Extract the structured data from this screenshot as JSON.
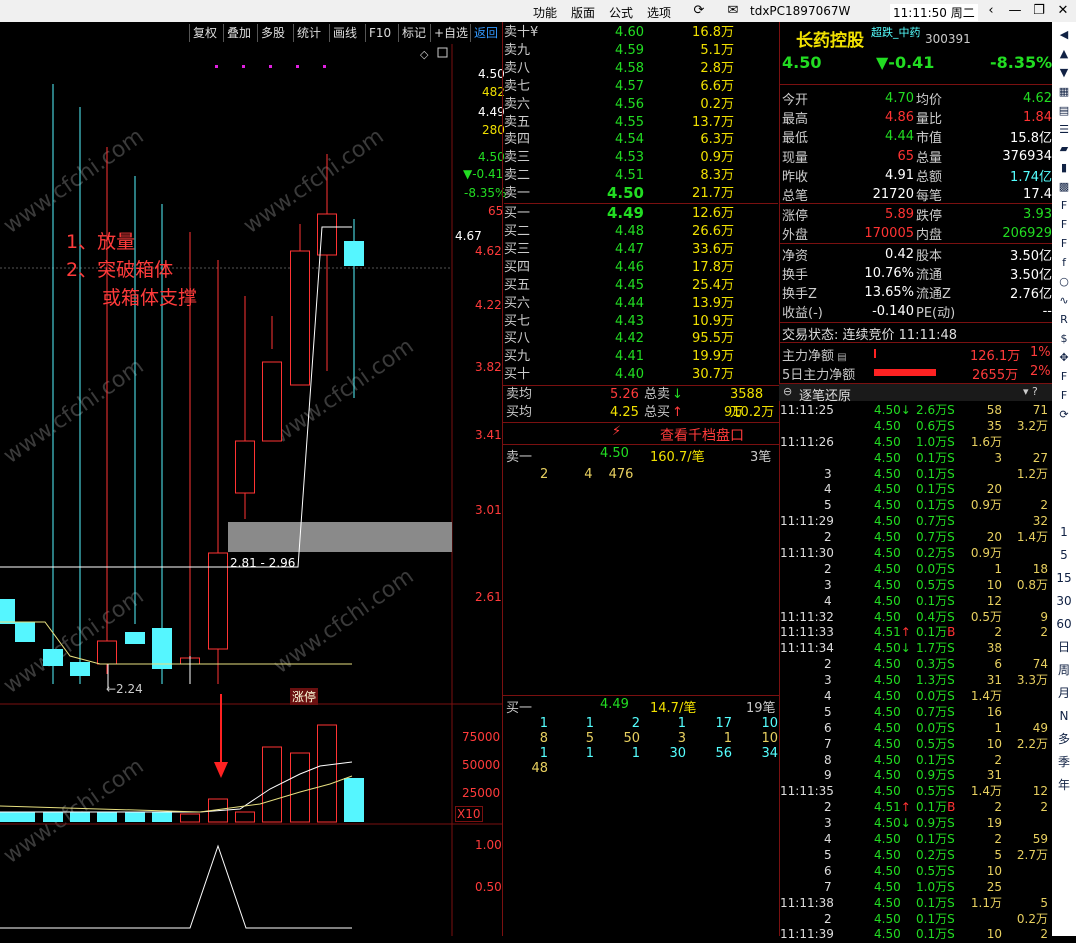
{
  "titlebar": {
    "menu": [
      "功能",
      "版面",
      "公式",
      "选项"
    ],
    "user": "tdxPC1897067W",
    "time": "11:11:50 周二",
    "buttons": [
      "refresh-icon",
      "mail-icon",
      "back-icon",
      "minimize-icon",
      "restore-icon",
      "close-icon"
    ]
  },
  "toolbar": [
    "复权",
    "叠加",
    "多股",
    "统计",
    "画线",
    "F10",
    "标记",
    "+自选",
    "返回"
  ],
  "annotation": {
    "line1": "1、放量",
    "line2": "2、突破箱体",
    "line3": "或箱体支撑"
  },
  "chart": {
    "price_axis": [
      "4.62",
      "4.22",
      "3.82",
      "3.41",
      "3.01",
      "2.61"
    ],
    "cursor_label": "4.67",
    "info": {
      "price": "4.50",
      "vol": "482",
      "price2": "4.49",
      "vol2": "280",
      "last": "4.50",
      "change": "▼-0.41",
      "pct": "-8.35%",
      "n": "65"
    },
    "box_label": "2.81 - 2.96",
    "low_label": "←2.24",
    "limit_tag": "涨停",
    "vol_axis": [
      "75000",
      "50000",
      "25000"
    ],
    "vol_unit": "X10",
    "ind_axis": [
      "1.00",
      "0.50"
    ],
    "watermark": "www.cfchi.com"
  },
  "orderbook": {
    "asks": [
      [
        "卖十¥",
        "4.60",
        "16.8万"
      ],
      [
        "卖九",
        "4.59",
        "5.1万"
      ],
      [
        "卖八",
        "4.58",
        "2.8万"
      ],
      [
        "卖七",
        "4.57",
        "6.6万"
      ],
      [
        "卖六",
        "4.56",
        "0.2万"
      ],
      [
        "卖五",
        "4.55",
        "13.7万"
      ],
      [
        "卖四",
        "4.54",
        "6.3万"
      ],
      [
        "卖三",
        "4.53",
        "0.9万"
      ],
      [
        "卖二",
        "4.51",
        "8.3万"
      ],
      [
        "卖一",
        "4.50",
        "21.7万"
      ]
    ],
    "bids": [
      [
        "买一",
        "4.49",
        "12.6万"
      ],
      [
        "买二",
        "4.48",
        "26.6万"
      ],
      [
        "买三",
        "4.47",
        "33.6万"
      ],
      [
        "买四",
        "4.46",
        "17.8万"
      ],
      [
        "买五",
        "4.45",
        "25.4万"
      ],
      [
        "买六",
        "4.44",
        "13.9万"
      ],
      [
        "买七",
        "4.43",
        "10.9万"
      ],
      [
        "买八",
        "4.42",
        "95.5万"
      ],
      [
        "买九",
        "4.41",
        "19.9万"
      ],
      [
        "买十",
        "4.40",
        "30.7万"
      ]
    ],
    "sell_avg_label": "卖均",
    "sell_avg": "5.26",
    "total_sell_label": "总卖",
    "total_sell": "3588万",
    "buy_avg_label": "买均",
    "buy_avg": "4.25",
    "total_buy_label": "总买",
    "total_buy": "910.2万",
    "depth_link": "查看千档盘口",
    "ask1_queue": {
      "label": "卖一",
      "price": "4.50",
      "vol": "160.7/笔",
      "count": "3笔",
      "items": [
        "2",
        "4",
        "476"
      ]
    },
    "bid1_queue": {
      "label": "买一",
      "price": "4.49",
      "vol": "14.7/笔",
      "count": "19笔",
      "rows": [
        [
          "1",
          "1",
          "2",
          "1",
          "17",
          "10"
        ],
        [
          "8",
          "5",
          "50",
          "3",
          "1",
          "10"
        ],
        [
          "1",
          "1",
          "1",
          "30",
          "56",
          "34"
        ],
        [
          "48"
        ]
      ]
    }
  },
  "quote": {
    "name": "长药控股",
    "tag": "超跌_中药",
    "code": "300391",
    "price": "4.50",
    "change": "▼-0.41",
    "pct": "-8.35%",
    "stats": [
      [
        "今开",
        "4.70",
        "均价",
        "4.62"
      ],
      [
        "最高",
        "4.86",
        "量比",
        "1.84"
      ],
      [
        "最低",
        "4.44",
        "市值",
        "15.8亿"
      ],
      [
        "现量",
        "65",
        "总量",
        "376934"
      ],
      [
        "昨收",
        "4.91",
        "总额",
        "1.74亿"
      ],
      [
        "总笔",
        "21720",
        "每笔",
        "17.4"
      ]
    ],
    "stats2": [
      [
        "涨停",
        "5.89",
        "跌停",
        "3.93"
      ],
      [
        "外盘",
        "170005",
        "内盘",
        "206929"
      ]
    ],
    "stats3": [
      [
        "净资",
        "0.42",
        "股本",
        "3.50亿"
      ],
      [
        "换手",
        "10.76%",
        "流通",
        "3.50亿"
      ],
      [
        "换手Z",
        "13.65%",
        "流通Z",
        "2.76亿"
      ],
      [
        "收益(-)",
        "-0.140",
        "PE(动)",
        "--"
      ]
    ],
    "trade_status": "交易状态: 连续竞价 11:11:48",
    "main_flow_label": "主力净额",
    "main_flow": "126.1万",
    "main_flow_pct": "1%",
    "main5_label": "5日主力净额",
    "main5": "2655万",
    "main5_pct": "2%",
    "ticks_title": "逐笔还原"
  },
  "ticks": [
    [
      "11:11:25",
      "4.50",
      "↓",
      "2.6万",
      "S",
      "58",
      "71"
    ],
    [
      "",
      "4.50",
      "",
      "0.6万",
      "S",
      "35",
      "3.2万"
    ],
    [
      "11:11:26",
      "4.50",
      "",
      "1.0万",
      "S",
      "1.6万",
      ""
    ],
    [
      "",
      "4.50",
      "",
      "0.1万",
      "S",
      "3",
      "27"
    ],
    [
      "3",
      "4.50",
      "",
      "0.1万",
      "S",
      "",
      "1.2万"
    ],
    [
      "4",
      "4.50",
      "",
      "0.1万",
      "S",
      "20",
      ""
    ],
    [
      "5",
      "4.50",
      "",
      "0.1万",
      "S",
      "0.9万",
      "2"
    ],
    [
      "11:11:29",
      "4.50",
      "",
      "0.7万",
      "S",
      "",
      "32"
    ],
    [
      "2",
      "4.50",
      "",
      "0.7万",
      "S",
      "20",
      "1.4万"
    ],
    [
      "11:11:30",
      "4.50",
      "",
      "0.2万",
      "S",
      "0.9万",
      ""
    ],
    [
      "2",
      "4.50",
      "",
      "0.0万",
      "S",
      "1",
      "18"
    ],
    [
      "3",
      "4.50",
      "",
      "0.5万",
      "S",
      "10",
      "0.8万"
    ],
    [
      "4",
      "4.50",
      "",
      "0.1万",
      "S",
      "12",
      ""
    ],
    [
      "11:11:32",
      "4.50",
      "",
      "0.4万",
      "S",
      "0.5万",
      "9"
    ],
    [
      "11:11:33",
      "4.51",
      "↑",
      "0.1万",
      "B",
      "2",
      "2"
    ],
    [
      "11:11:34",
      "4.50",
      "↓",
      "1.7万",
      "S",
      "38",
      ""
    ],
    [
      "2",
      "4.50",
      "",
      "0.3万",
      "S",
      "6",
      "74"
    ],
    [
      "3",
      "4.50",
      "",
      "1.3万",
      "S",
      "31",
      "3.3万"
    ],
    [
      "4",
      "4.50",
      "",
      "0.0万",
      "S",
      "1.4万",
      ""
    ],
    [
      "5",
      "4.50",
      "",
      "0.7万",
      "S",
      "16",
      ""
    ],
    [
      "6",
      "4.50",
      "",
      "0.0万",
      "S",
      "1",
      "49"
    ],
    [
      "7",
      "4.50",
      "",
      "0.5万",
      "S",
      "10",
      "2.2万"
    ],
    [
      "8",
      "4.50",
      "",
      "0.1万",
      "S",
      "2",
      ""
    ],
    [
      "9",
      "4.50",
      "",
      "0.9万",
      "S",
      "31",
      ""
    ],
    [
      "11:11:35",
      "4.50",
      "",
      "0.5万",
      "S",
      "1.4万",
      "12"
    ],
    [
      "2",
      "4.51",
      "↑",
      "0.1万",
      "B",
      "2",
      "2"
    ],
    [
      "3",
      "4.50",
      "↓",
      "0.9万",
      "S",
      "19",
      ""
    ],
    [
      "4",
      "4.50",
      "",
      "0.1万",
      "S",
      "2",
      "59"
    ],
    [
      "5",
      "4.50",
      "",
      "0.2万",
      "S",
      "5",
      "2.7万"
    ],
    [
      "6",
      "4.50",
      "",
      "0.5万",
      "S",
      "10",
      ""
    ],
    [
      "7",
      "4.50",
      "",
      "1.0万",
      "S",
      "25",
      ""
    ],
    [
      "11:11:38",
      "4.50",
      "",
      "0.1万",
      "S",
      "1.1万",
      "5"
    ],
    [
      "2",
      "4.50",
      "",
      "0.1万",
      "S",
      "",
      "0.2万"
    ],
    [
      "11:11:39",
      "4.50",
      "",
      "0.1万",
      "S",
      "10",
      "2"
    ]
  ],
  "rightbar": [
    "1",
    "5",
    "15",
    "30",
    "60",
    "日",
    "周",
    "月",
    "N",
    "多",
    "季",
    "年"
  ],
  "rightbar_icons": [
    "arrow-left-icon",
    "arrow-up-icon",
    "arrow-down-icon",
    "grid-icon",
    "doc-icon",
    "list-icon",
    "chart-icon",
    "candle-icon",
    "table-icon",
    "f10-icon",
    "f-icon",
    "fz-icon",
    "fx-icon",
    "circle-icon",
    "wave-icon",
    "rsi-icon",
    "dollar-icon",
    "move-icon",
    "f2-icon",
    "f5-icon",
    "refresh-icon"
  ]
}
